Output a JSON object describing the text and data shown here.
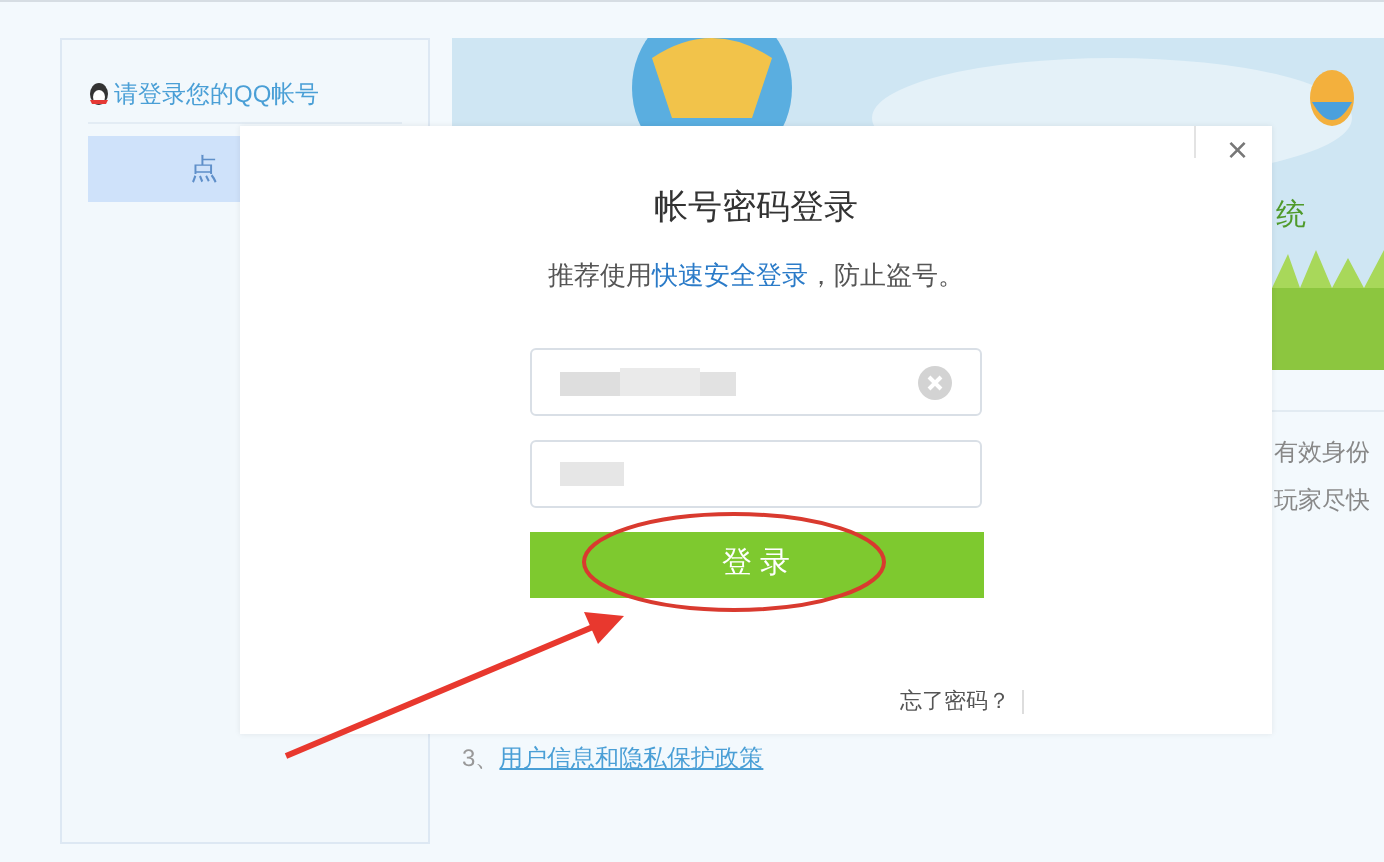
{
  "sidebar": {
    "title": "请登录您的QQ帐号",
    "button": "点"
  },
  "banner": {
    "kind": "picture",
    "caption": "统"
  },
  "notice_lines": [
    "有效身份",
    "玩家尽快"
  ],
  "policy": {
    "number": "3、",
    "link": "用户信息和隐私保护政策"
  },
  "dialog": {
    "close": "×",
    "title": "帐号密码登录",
    "hint_before": "推荐使用",
    "hint_link": "快速安全登录",
    "hint_after": "，防止盗号。",
    "login_button": "登 录",
    "forgot": "忘了密码？"
  }
}
